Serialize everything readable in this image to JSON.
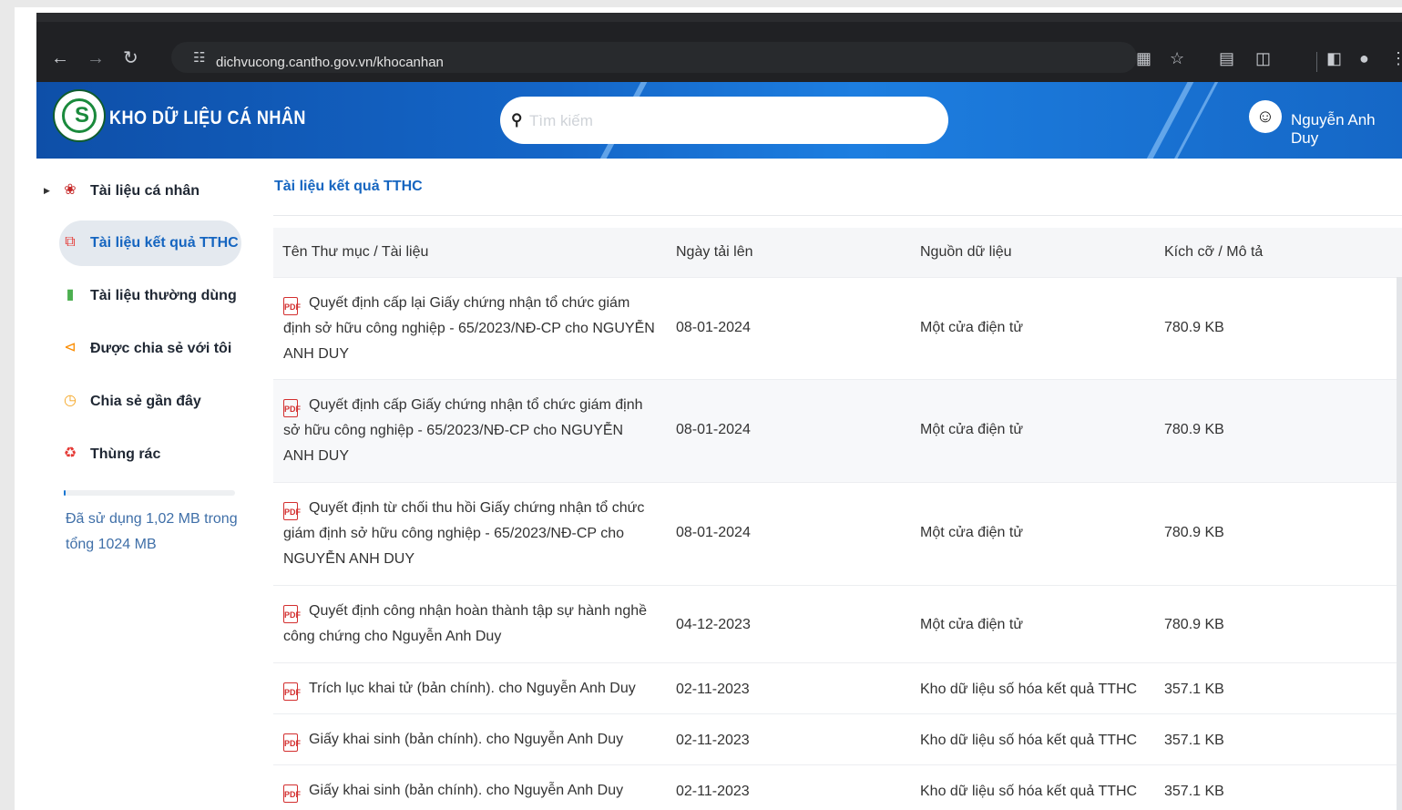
{
  "browser": {
    "url": "dichvucong.cantho.gov.vn/khocanhan",
    "icons": [
      "back-icon",
      "forward-icon",
      "reload-icon",
      "site-settings-icon",
      "translate-icon",
      "star-icon",
      "reading-list-icon",
      "extensions-icon",
      "side-panel-icon",
      "profile-icon",
      "menu-icon"
    ]
  },
  "header": {
    "brand": "KHO DỮ LIỆU CÁ NHÂN",
    "search_placeholder": "Tìm kiếm",
    "user_name": "Nguyễn Anh Duy",
    "colors": {
      "banner": "#1466c8",
      "accent": "#1565c0"
    }
  },
  "sidebar": {
    "items": [
      {
        "label": "Tài liệu cá nhân",
        "icon": "personal-docs-icon",
        "active": false
      },
      {
        "label": "Tài liệu kết quả TTHC",
        "icon": "result-docs-icon",
        "active": true
      },
      {
        "label": "Tài liệu thường dùng",
        "icon": "frequent-docs-icon",
        "active": false
      },
      {
        "label": "Được chia sẻ với tôi",
        "icon": "shared-with-me-icon",
        "active": false
      },
      {
        "label": "Chia sẻ gần đây",
        "icon": "recent-share-icon",
        "active": false
      },
      {
        "label": "Thùng rác",
        "icon": "trash-icon",
        "active": false
      }
    ],
    "storage": {
      "text": "Đã sử dụng 1,02 MB trong tổng 1024 MB",
      "used_mb": 1.02,
      "total_mb": 1024
    }
  },
  "main": {
    "breadcrumb": "Tài liệu kết quả TTHC",
    "columns": [
      "Tên Thư mục / Tài liệu",
      "Ngày tải lên",
      "Nguồn dữ liệu",
      "Kích cỡ / Mô tả"
    ],
    "rows": [
      {
        "name": "Quyết định cấp lại Giấy chứng nhận tổ chức giám định sở hữu công nghiệp - 65/2023/NĐ-CP cho NGUYỄN ANH DUY",
        "date": "08-01-2024",
        "source": "Một cửa điện tử",
        "size": "780.9 KB"
      },
      {
        "name": "Quyết định cấp Giấy chứng nhận tổ chức giám định sở hữu công nghiệp - 65/2023/NĐ-CP cho NGUYỄN ANH DUY",
        "date": "08-01-2024",
        "source": "Một cửa điện tử",
        "size": "780.9 KB"
      },
      {
        "name": "Quyết định từ chối thu hồi Giấy chứng nhận tổ chức giám định sở hữu công nghiệp - 65/2023/NĐ-CP cho NGUYỄN ANH DUY",
        "date": "08-01-2024",
        "source": "Một cửa điện tử",
        "size": "780.9 KB"
      },
      {
        "name": "Quyết định công nhận hoàn thành tập sự hành nghề công chứng cho Nguyễn Anh Duy",
        "date": "04-12-2023",
        "source": "Một cửa điện tử",
        "size": "780.9 KB"
      },
      {
        "name": "Trích lục khai tử (bản chính). cho Nguyễn Anh Duy",
        "date": "02-11-2023",
        "source": "Kho dữ liệu số hóa kết quả TTHC",
        "size": "357.1 KB"
      },
      {
        "name": "Giấy khai sinh (bản chính). cho Nguyễn Anh Duy",
        "date": "02-11-2023",
        "source": "Kho dữ liệu số hóa kết quả TTHC",
        "size": "357.1 KB"
      },
      {
        "name": "Giấy khai sinh (bản chính). cho Nguyễn Anh Duy",
        "date": "02-11-2023",
        "source": "Kho dữ liệu số hóa kết quả TTHC",
        "size": "357.1 KB"
      }
    ]
  }
}
